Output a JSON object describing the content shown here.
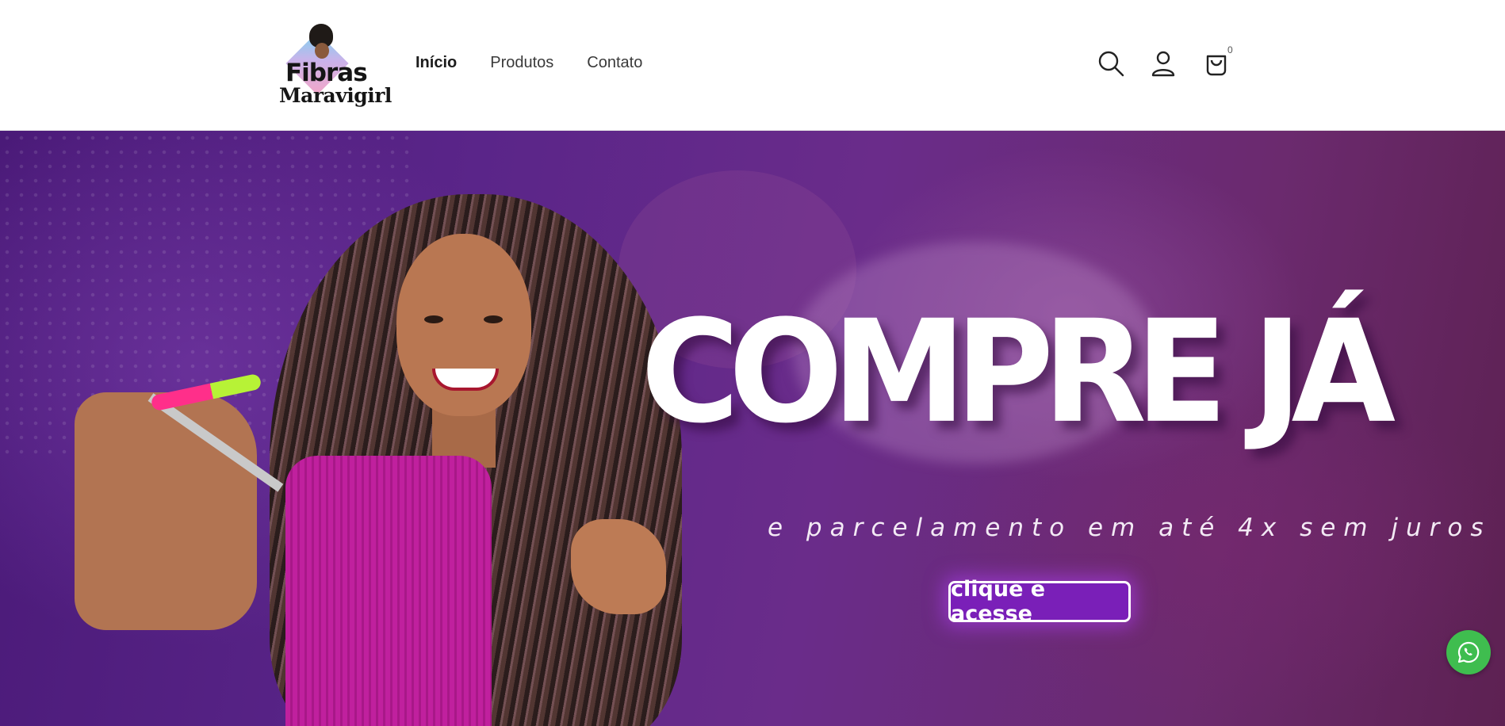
{
  "brand": {
    "logo_line1": "Fibras",
    "logo_line2": "Maravigirl"
  },
  "nav": {
    "items": [
      {
        "label": "Início",
        "active": true
      },
      {
        "label": "Produtos",
        "active": false
      },
      {
        "label": "Contato",
        "active": false
      }
    ]
  },
  "header_icons": [
    "search-icon",
    "account-icon",
    "cart-icon"
  ],
  "cart": {
    "count": "0"
  },
  "hero": {
    "headline": "COMPRE JÁ",
    "subline": "e parcelamento em até 4x sem juros",
    "cta_label": "clique e acesse"
  },
  "floating": {
    "icon": "whatsapp-icon"
  },
  "colors": {
    "hero_purple": "#5a2589",
    "cta_purple": "#7a1fb8",
    "whatsapp_green": "#3fbd4f"
  }
}
